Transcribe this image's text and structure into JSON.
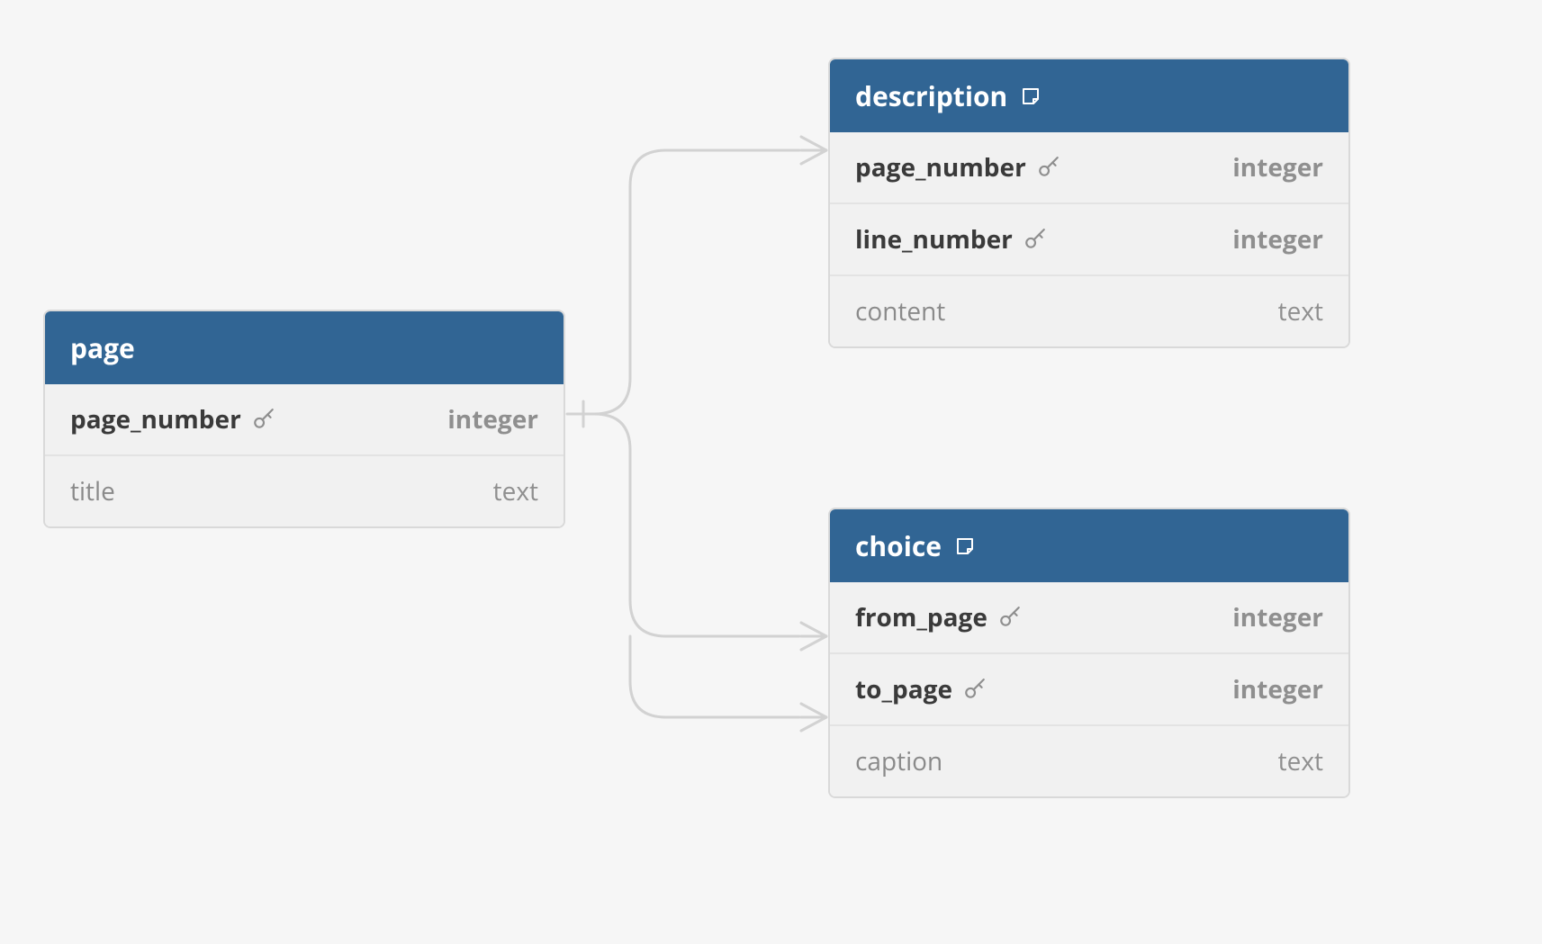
{
  "tables": {
    "page": {
      "name": "page",
      "has_note": false,
      "columns": [
        {
          "name": "page_number",
          "type": "integer",
          "pk": true
        },
        {
          "name": "title",
          "type": "text",
          "pk": false
        }
      ]
    },
    "description": {
      "name": "description",
      "has_note": true,
      "columns": [
        {
          "name": "page_number",
          "type": "integer",
          "pk": true
        },
        {
          "name": "line_number",
          "type": "integer",
          "pk": true
        },
        {
          "name": "content",
          "type": "text",
          "pk": false
        }
      ]
    },
    "choice": {
      "name": "choice",
      "has_note": true,
      "columns": [
        {
          "name": "from_page",
          "type": "integer",
          "pk": true
        },
        {
          "name": "to_page",
          "type": "integer",
          "pk": true
        },
        {
          "name": "caption",
          "type": "text",
          "pk": false
        }
      ]
    }
  },
  "relationships": [
    {
      "from_table": "page",
      "from_column": "page_number",
      "to_table": "description",
      "to_column": "page_number",
      "cardinality": "one-to-many"
    },
    {
      "from_table": "page",
      "from_column": "page_number",
      "to_table": "choice",
      "to_column": "from_page",
      "cardinality": "one-to-many"
    },
    {
      "from_table": "page",
      "from_column": "page_number",
      "to_table": "choice",
      "to_column": "to_page",
      "cardinality": "one-to-many"
    }
  ],
  "icons": {
    "key": "key-icon",
    "note": "note-icon"
  }
}
